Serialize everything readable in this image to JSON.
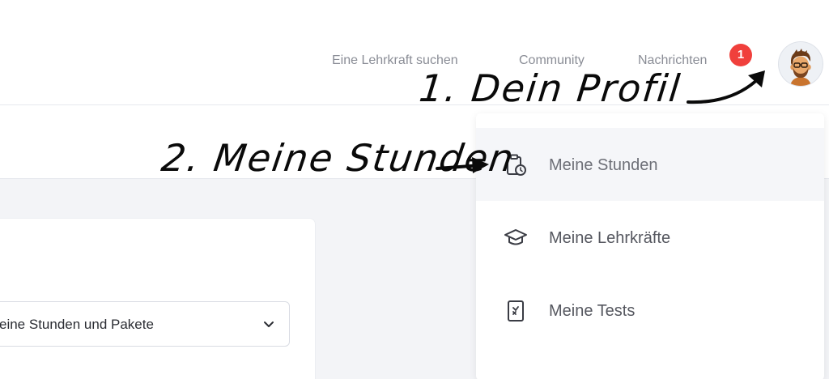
{
  "nav": {
    "links": [
      "Eine Lehrkraft suchen",
      "Community",
      "Nachrichten"
    ],
    "messages_badge": "1",
    "avatar_icon": "user-avatar"
  },
  "content": {
    "select_value": "eine Stunden und Pakete",
    "select_icon": "chevron-down-icon"
  },
  "dropdown": {
    "items": [
      {
        "label": "Meine Stunden",
        "icon": "clipboard-clock-icon",
        "active": true
      },
      {
        "label": "Meine Lehrkräfte",
        "icon": "graduation-cap-icon",
        "active": false
      },
      {
        "label": "Meine Tests",
        "icon": "test-document-icon",
        "active": false
      }
    ]
  },
  "annotations": {
    "step1": "1. Dein Profil",
    "step2": "2. Meine Stunden"
  },
  "colors": {
    "badge": "#f0403c",
    "nav_text": "#8a8d96",
    "menu_active_bg": "#f5f6f9",
    "page_bg": "#f3f4f7"
  }
}
